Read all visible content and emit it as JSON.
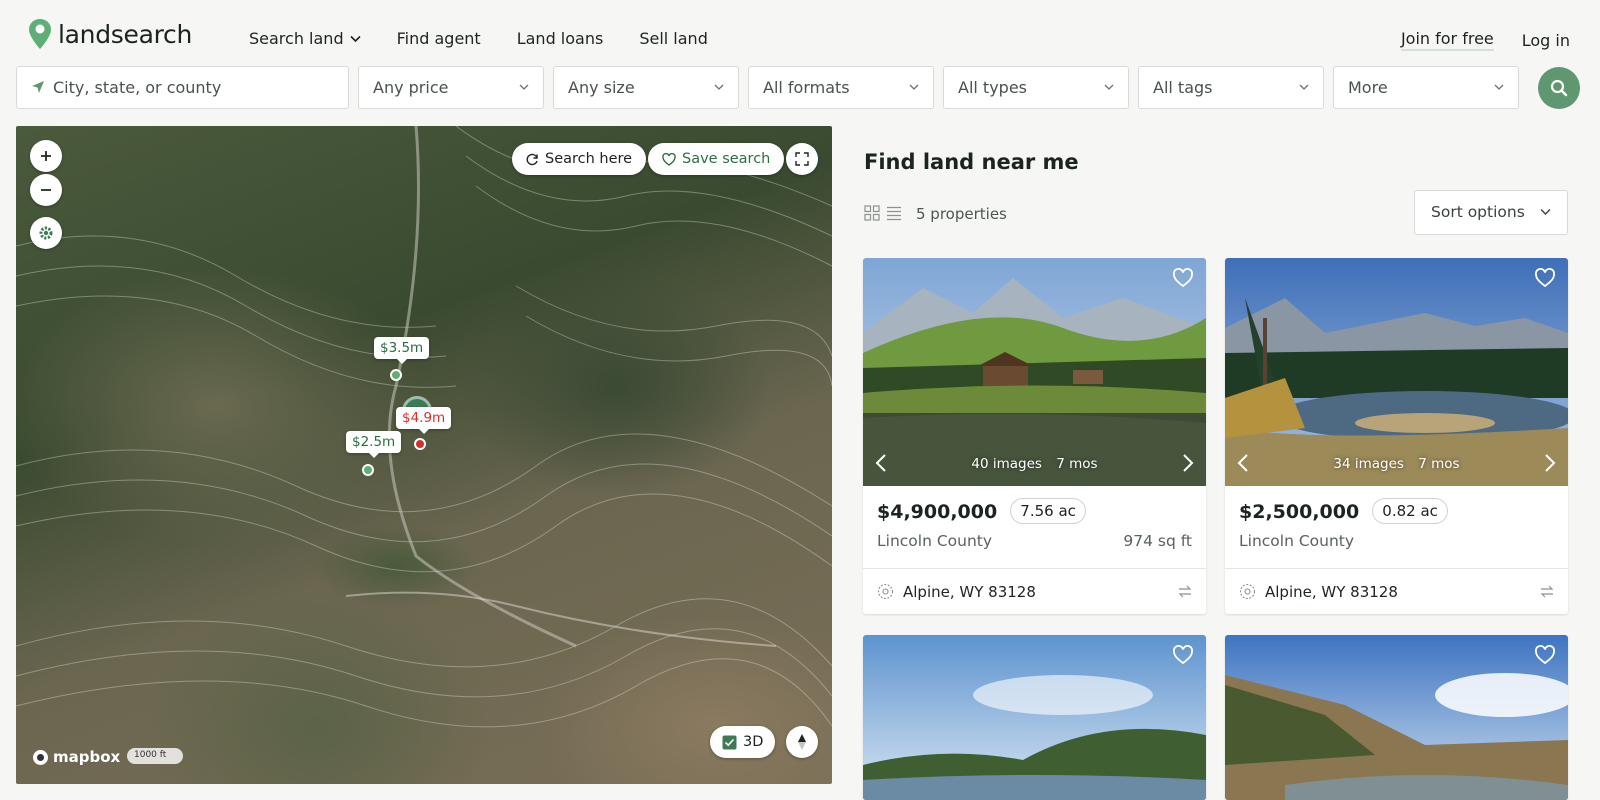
{
  "brand": {
    "name": "landsearch",
    "accent": "#5f9770"
  },
  "nav": {
    "search_land": "Search land",
    "find_agent": "Find agent",
    "land_loans": "Land loans",
    "sell_land": "Sell land",
    "join": "Join for free",
    "login": "Log in"
  },
  "filters": {
    "location_placeholder": "City, state, or county",
    "price": "Any price",
    "size": "Any size",
    "formats": "All formats",
    "types": "All types",
    "tags": "All tags",
    "more": "More"
  },
  "map": {
    "search_here": "Search here",
    "save_search": "Save search",
    "three_d": "3D",
    "attribution": "mapbox",
    "scale": "1000 ft",
    "markers": [
      {
        "label": "$3.5m",
        "color": "green"
      },
      {
        "label": "$4.9m",
        "color": "red"
      },
      {
        "label": "$2.5m",
        "color": "green"
      }
    ]
  },
  "panel": {
    "title": "Find land near me",
    "count": "5 properties",
    "sort": "Sort options"
  },
  "listings": [
    {
      "price": "$4,900,000",
      "acres": "7.56 ac",
      "county": "Lincoln County",
      "sqft": "974 sq ft",
      "images": "40 images",
      "age": "7 mos",
      "location": "Alpine, WY 83128"
    },
    {
      "price": "$2,500,000",
      "acres": "0.82 ac",
      "county": "Lincoln County",
      "sqft": "",
      "images": "34 images",
      "age": "7 mos",
      "location": "Alpine, WY 83128"
    }
  ]
}
